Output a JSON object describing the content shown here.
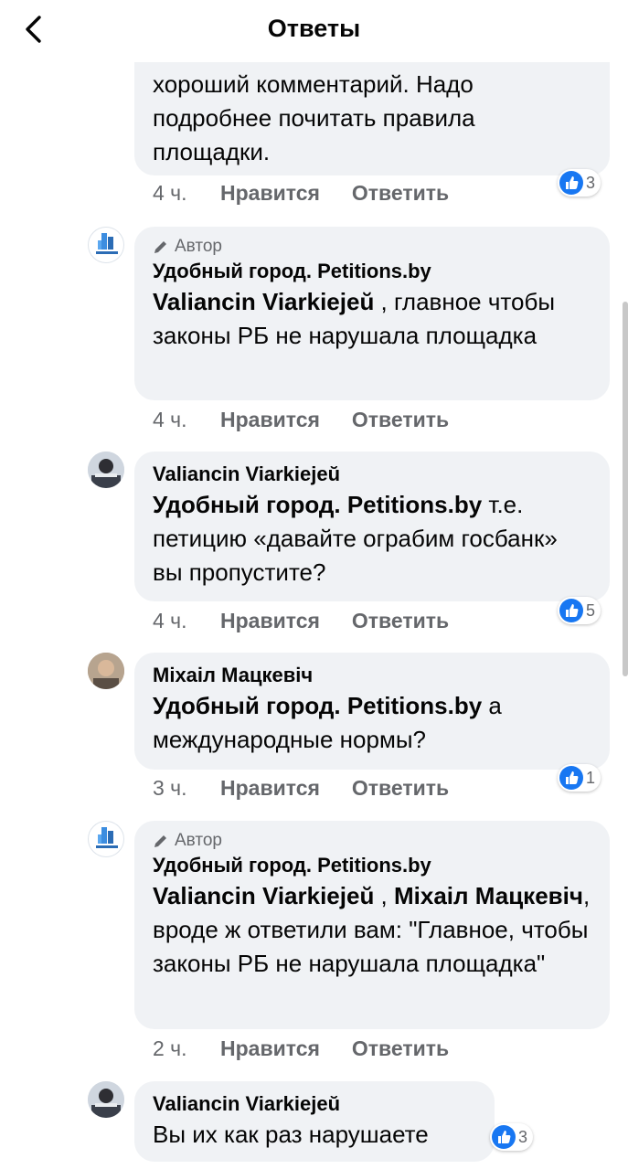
{
  "header": {
    "title": "Ответы",
    "back_icon": "chevron-left-icon"
  },
  "comments": [
    {
      "text": "хороший комментарий. Надо подробнее почитать правила площадки.",
      "time": "4 ч.",
      "like": "Нравится",
      "reply": "Ответить",
      "reactions": "3"
    },
    {
      "author_tag": "Автор",
      "name": "Удобный город. Petitions.by",
      "mention": "Valiancin Viarkiejeŭ",
      "text": " , главное чтобы законы РБ не нарушала площадка",
      "time": "4 ч.",
      "like": "Нравится",
      "reply": "Ответить"
    },
    {
      "name": "Valiancin Viarkiejeŭ",
      "mention": "Удобный город. Petitions.by",
      "text": " т.е. петицию «давайте ограбим госбанк» вы пропустите?",
      "time": "4 ч.",
      "like": "Нравится",
      "reply": "Ответить",
      "reactions": "5"
    },
    {
      "name": "Міхаіл Мацкевіч",
      "mention": "Удобный город. Petitions.by",
      "text": " а международные нормы?",
      "time": "3 ч.",
      "like": "Нравится",
      "reply": "Ответить",
      "reactions": "1"
    },
    {
      "author_tag": "Автор",
      "name": "Удобный город. Petitions.by",
      "mention": "Valiancin Viarkiejeŭ",
      "mention_sep": " , ",
      "mention2": "Міхаіл Мацкевіч",
      "text": ", вроде ж ответили вам: \"Главное, чтобы законы РБ не нарушала площадка\"",
      "time": "2 ч.",
      "like": "Нравится",
      "reply": "Ответить"
    },
    {
      "name": "Valiancin Viarkiejeŭ",
      "text": "Вы их как раз нарушаете",
      "reactions": "3"
    }
  ],
  "colors": {
    "bubble": "#f0f2f5",
    "like_blue": "#1877f2",
    "meta_gray": "#65676b"
  }
}
